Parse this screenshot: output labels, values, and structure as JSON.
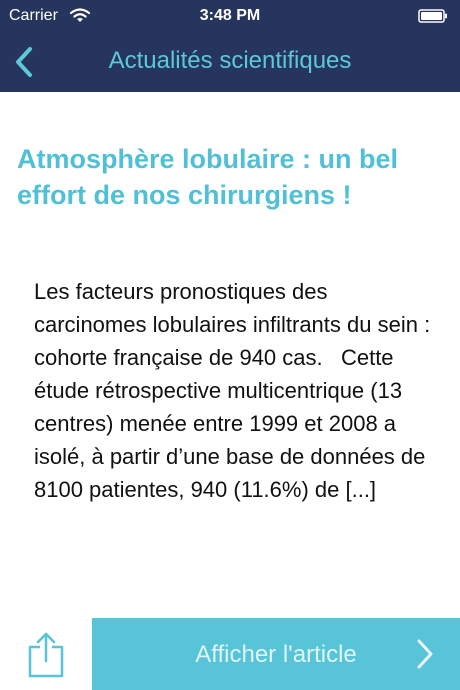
{
  "status_bar": {
    "carrier": "Carrier",
    "time": "3:48 PM",
    "wifi_icon": "wifi-icon",
    "battery_icon": "battery-icon"
  },
  "nav": {
    "back_icon": "chevron-left-icon",
    "title": "Actualités scientifiques",
    "background": "#26355d",
    "accent": "#5cc8d8"
  },
  "article": {
    "title": "Atmosphère lobulaire : un bel effort de nos chirurgiens !",
    "excerpt": "Les facteurs pronostiques des carcinomes lobulaires infiltrants du sein : cohorte française de 940 cas.   Cette étude rétrospective multicentrique (13 centres) menée entre 1999 et 2008 a isolé, à partir d’une base de données de 8100 patientes, 940 (11.6%) de [...]",
    "title_color": "#4fc0d5"
  },
  "footer": {
    "share_icon": "share-icon",
    "open_article_label": "Afficher l'article",
    "open_article_icon": "chevron-right-icon",
    "button_color": "#57c4d8"
  }
}
